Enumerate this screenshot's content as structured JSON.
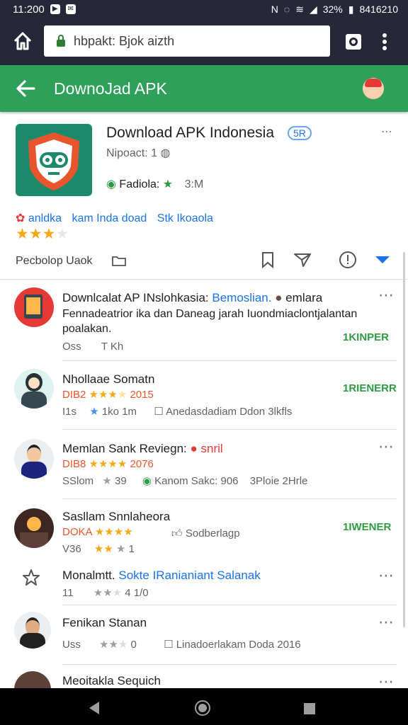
{
  "status_bar": {
    "time": "11:200",
    "battery": "32%",
    "right_text": "8416210"
  },
  "browser": {
    "url": "hbpakt: Bjok aizth"
  },
  "app_bar": {
    "title": "DownoJad APK"
  },
  "app": {
    "name": "Download APK Indonesia",
    "badge": "5R",
    "developer": "Nipoact: 1",
    "rating_label": "Fadiola:",
    "size": "3:M",
    "tags": [
      "anldka",
      "kam Inda doad",
      "Stk Ikoaola"
    ],
    "stars": 3,
    "action_label": "Pecbolop Uaok"
  },
  "comments": [
    {
      "title": "Downlcalat AP INslohkasia:",
      "title_link": "Bemoslian.",
      "title_tail": "emlara",
      "body": "Fennadeatrior ika dan Daneag jarah Iuondmiaclontjalantan poalakan.",
      "meta1": "Oss",
      "meta2": "T Kh",
      "badge": "1KINPER"
    },
    {
      "title": "Nhollaae Somatn",
      "subtitle": "DIB2",
      "sub_year": "2015",
      "meta1": "I1s",
      "meta2": "1ko 1m",
      "meta3": "Anedasdadiam Ddon 3lkfls",
      "badge": "1RIENERR"
    },
    {
      "title": "Memlan Sank Reviegn:",
      "title_tail": "snril",
      "subtitle": "DIB8",
      "sub_year": "2076",
      "meta1": "SSlom",
      "meta2": "39",
      "meta3": "Kanom Sakc: 906",
      "meta4": "3Ploie 2Hrle"
    },
    {
      "title": "Sasllam Snnlaheora",
      "subtitle": "DOKA",
      "meta1": "V36",
      "meta2": "1",
      "meta3": "Sodberlagp",
      "badge": "1IWENER"
    },
    {
      "title": "Monalmtt.",
      "title_link": "Sokte IRanianiant Salanak",
      "meta1": "11",
      "meta2": "4 1/0"
    },
    {
      "title": "Fenikan Stanan",
      "meta1": "Uss",
      "meta2": "0",
      "meta3": "Linadoerlakam Doda 2016"
    },
    {
      "title": "Meoitakla Sequich"
    }
  ],
  "colors": {
    "topbar": "#27273a",
    "green": "#2fa05a",
    "star": "#f6a819",
    "link": "#1a73e8",
    "badge": "#2e9b43"
  }
}
